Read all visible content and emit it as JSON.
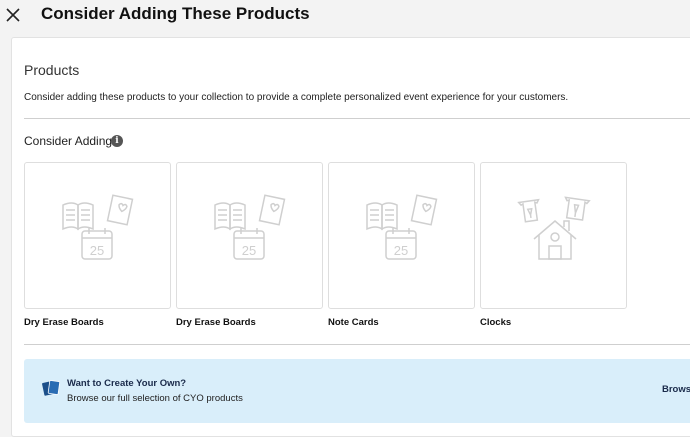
{
  "header": {
    "title": "Consider Adding These Products"
  },
  "section": {
    "title": "Products",
    "description": "Consider adding these products to your collection to provide a complete personalized event experience for your customers.",
    "consider_label": "Consider Adding",
    "info_glyph": "i"
  },
  "products": [
    {
      "label": "Dry Erase Boards",
      "icon": "stationery-placeholder-icon"
    },
    {
      "label": "Dry Erase Boards",
      "icon": "stationery-placeholder-icon"
    },
    {
      "label": "Note Cards",
      "icon": "stationery-placeholder-icon"
    },
    {
      "label": "Clocks",
      "icon": "home-decor-placeholder-icon"
    }
  ],
  "calendar_day": "25",
  "banner": {
    "title": "Want to Create Your Own?",
    "subtitle": "Browse our full selection of CYO products",
    "link": "Browse C",
    "icon": "cyo-cards-icon"
  },
  "colors": {
    "banner_bg": "#d9eefa",
    "banner_icon": "#1b4f8a",
    "placeholder_stroke": "#cfcfcf"
  }
}
